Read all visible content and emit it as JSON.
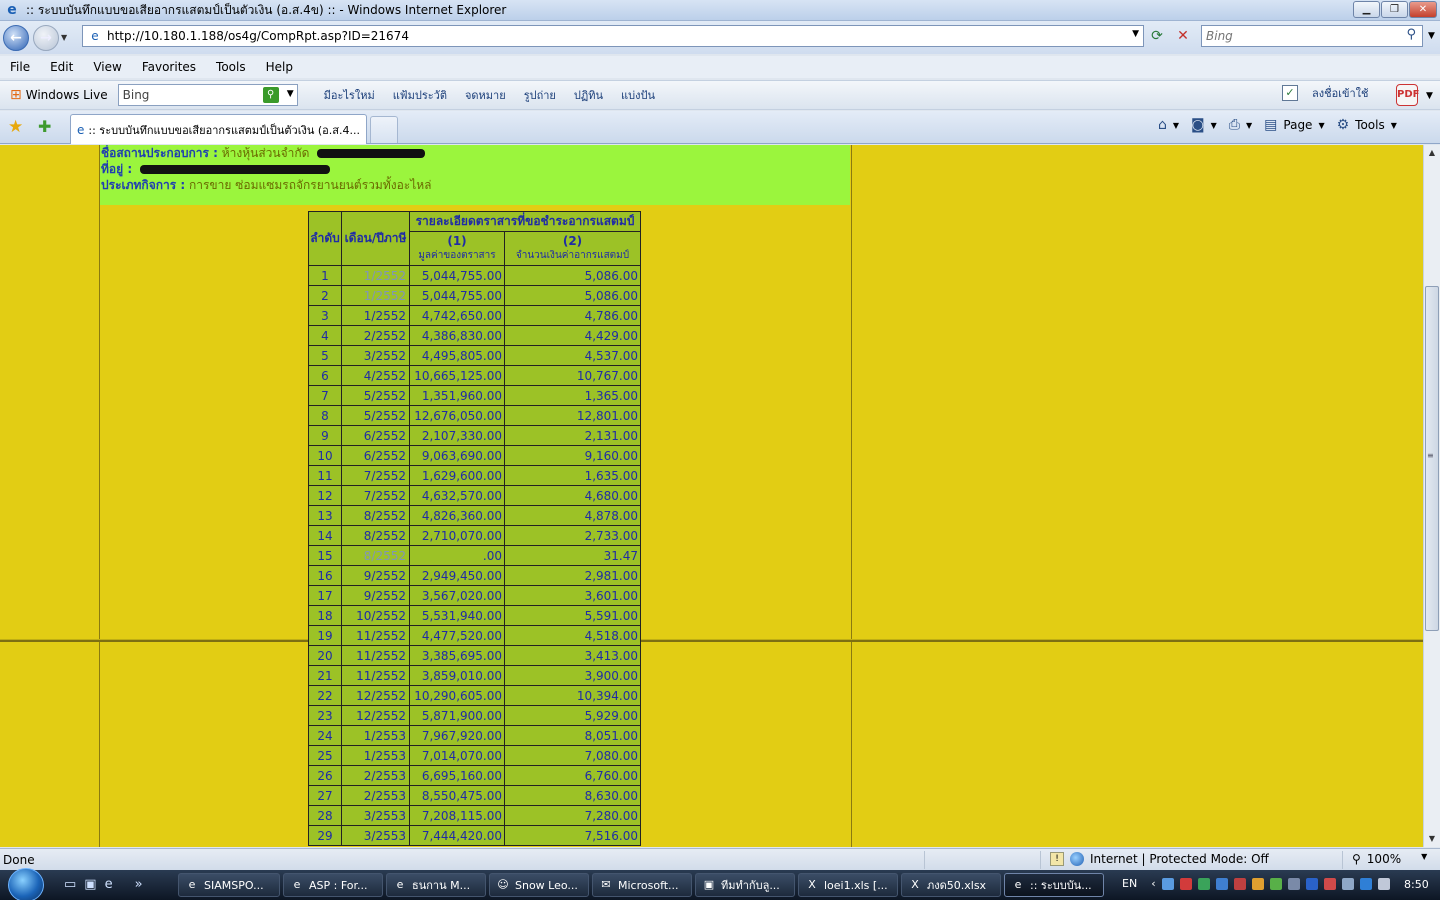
{
  "window": {
    "title": ":: ระบบบันทึกแบบขอเสียอากรแสตมป์เป็นตัวเงิน (อ.ส.4ข) :: - Windows Internet Explorer",
    "min": "▁",
    "max": "❐",
    "close": "✕"
  },
  "address": {
    "url": "http://10.180.1.188/os4g/CompRpt.asp?ID=21674",
    "search_placeholder": "Bing"
  },
  "menu": [
    "File",
    "Edit",
    "View",
    "Favorites",
    "Tools",
    "Help"
  ],
  "live": {
    "brand": "Windows Live",
    "search_value": "Bing",
    "links": [
      "มีอะไรใหม่",
      "แฟ้มประวัติ",
      "จดหมาย",
      "รูปถ่าย",
      "ปฏิทิน",
      "แบ่งปัน"
    ],
    "signin": "ลงชื่อเข้าใช้"
  },
  "tab": {
    "title": ":: ระบบบันทึกแบบขอเสียอากรแสตมป์เป็นตัวเงิน (อ.ส.4..."
  },
  "command": {
    "page": "Page",
    "tools": "Tools"
  },
  "info": {
    "place_label": "ชื่อสถานประกอบการ :",
    "place_value": "ห้างหุ้นส่วนจำกัด",
    "address_label": "ที่อยู่ :",
    "business_label": "ประเภทกิจการ :",
    "business_value": "การขาย ซ่อมแซมรถจักรยานยนต์รวมทั้งอะไหล่"
  },
  "table": {
    "h_no": "ลำดับ",
    "h_month": "เดือน/ปีภาษี",
    "h_group": "รายละเอียดตราสารที่ขอชำระอากรแสตมป์",
    "h1_num": "(1)",
    "h1_text": "มูลค่าของตราสาร",
    "h2_num": "(2)",
    "h2_text": "จำนวนเงินค่าอากรแสตมป์",
    "rows": [
      {
        "no": "1",
        "month": "1/2552",
        "value": "5,044,755.00",
        "duty": "5,086.00",
        "dim": true
      },
      {
        "no": "2",
        "month": "1/2552",
        "value": "5,044,755.00",
        "duty": "5,086.00",
        "dim": true
      },
      {
        "no": "3",
        "month": "1/2552",
        "value": "4,742,650.00",
        "duty": "4,786.00",
        "dim": false
      },
      {
        "no": "4",
        "month": "2/2552",
        "value": "4,386,830.00",
        "duty": "4,429.00",
        "dim": false
      },
      {
        "no": "5",
        "month": "3/2552",
        "value": "4,495,805.00",
        "duty": "4,537.00",
        "dim": false
      },
      {
        "no": "6",
        "month": "4/2552",
        "value": "10,665,125.00",
        "duty": "10,767.00",
        "dim": false
      },
      {
        "no": "7",
        "month": "5/2552",
        "value": "1,351,960.00",
        "duty": "1,365.00",
        "dim": false
      },
      {
        "no": "8",
        "month": "5/2552",
        "value": "12,676,050.00",
        "duty": "12,801.00",
        "dim": false
      },
      {
        "no": "9",
        "month": "6/2552",
        "value": "2,107,330.00",
        "duty": "2,131.00",
        "dim": false
      },
      {
        "no": "10",
        "month": "6/2552",
        "value": "9,063,690.00",
        "duty": "9,160.00",
        "dim": false
      },
      {
        "no": "11",
        "month": "7/2552",
        "value": "1,629,600.00",
        "duty": "1,635.00",
        "dim": false
      },
      {
        "no": "12",
        "month": "7/2552",
        "value": "4,632,570.00",
        "duty": "4,680.00",
        "dim": false
      },
      {
        "no": "13",
        "month": "8/2552",
        "value": "4,826,360.00",
        "duty": "4,878.00",
        "dim": false
      },
      {
        "no": "14",
        "month": "8/2552",
        "value": "2,710,070.00",
        "duty": "2,733.00",
        "dim": false
      },
      {
        "no": "15",
        "month": "8/2552",
        "value": ".00",
        "duty": "31.47",
        "dim": true
      },
      {
        "no": "16",
        "month": "9/2552",
        "value": "2,949,450.00",
        "duty": "2,981.00",
        "dim": false
      },
      {
        "no": "17",
        "month": "9/2552",
        "value": "3,567,020.00",
        "duty": "3,601.00",
        "dim": false
      },
      {
        "no": "18",
        "month": "10/2552",
        "value": "5,531,940.00",
        "duty": "5,591.00",
        "dim": false
      },
      {
        "no": "19",
        "month": "11/2552",
        "value": "4,477,520.00",
        "duty": "4,518.00",
        "dim": false
      },
      {
        "no": "20",
        "month": "11/2552",
        "value": "3,385,695.00",
        "duty": "3,413.00",
        "dim": false
      },
      {
        "no": "21",
        "month": "11/2552",
        "value": "3,859,010.00",
        "duty": "3,900.00",
        "dim": false
      },
      {
        "no": "22",
        "month": "12/2552",
        "value": "10,290,605.00",
        "duty": "10,394.00",
        "dim": false
      },
      {
        "no": "23",
        "month": "12/2552",
        "value": "5,871,900.00",
        "duty": "5,929.00",
        "dim": false
      },
      {
        "no": "24",
        "month": "1/2553",
        "value": "7,967,920.00",
        "duty": "8,051.00",
        "dim": false
      },
      {
        "no": "25",
        "month": "1/2553",
        "value": "7,014,070.00",
        "duty": "7,080.00",
        "dim": false
      },
      {
        "no": "26",
        "month": "2/2553",
        "value": "6,695,160.00",
        "duty": "6,760.00",
        "dim": false
      },
      {
        "no": "27",
        "month": "2/2553",
        "value": "8,550,475.00",
        "duty": "8,630.00",
        "dim": false
      },
      {
        "no": "28",
        "month": "3/2553",
        "value": "7,208,115.00",
        "duty": "7,280.00",
        "dim": false
      },
      {
        "no": "29",
        "month": "3/2553",
        "value": "7,444,420.00",
        "duty": "7,516.00",
        "dim": false
      }
    ]
  },
  "status": {
    "left": "Done",
    "zone": "Internet | Protected Mode: Off",
    "zoom": "100%"
  },
  "taskbar": {
    "items": [
      {
        "label": "SIAMSPO...",
        "icon": "ie-icon",
        "w": 102
      },
      {
        "label": "ASP : For...",
        "icon": "ie-icon",
        "w": 100
      },
      {
        "label": "ธนกาน M...",
        "icon": "ie-icon",
        "w": 100
      },
      {
        "label": "Snow Leo...",
        "icon": "messenger-icon",
        "w": 100
      },
      {
        "label": "Microsoft...",
        "icon": "outlook-icon",
        "w": 100
      },
      {
        "label": "ทีมทำกับลู...",
        "icon": "folder-icon",
        "w": 100
      },
      {
        "label": "loei1.xls  [...",
        "icon": "excel-icon",
        "w": 100
      },
      {
        "label": "ภงด50.xlsx",
        "icon": "excel-icon",
        "w": 100
      },
      {
        "label": ":: ระบบบัน...",
        "icon": "ie-icon",
        "w": 100
      }
    ],
    "lang": "EN",
    "time": "8:50"
  },
  "colors": {
    "page_bg": "#e2cd14",
    "info_bg": "#9bf53d",
    "table_bg": "#9cc226",
    "table_text": "#1f2ca5"
  }
}
